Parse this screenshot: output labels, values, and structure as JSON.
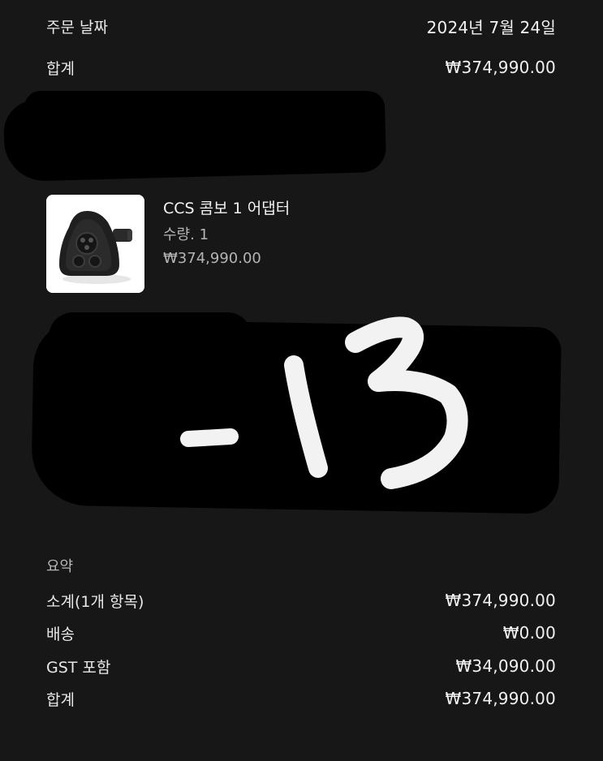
{
  "order": {
    "date_label": "주문 날짜",
    "date_value": "2024년 7월 24일",
    "total_label": "합계",
    "total_value": "₩374,990.00"
  },
  "product": {
    "title": "CCS 콤보 1 어댑터",
    "quantity": "수량. 1",
    "price": "₩374,990.00",
    "image_icon": "adapter-image"
  },
  "handwritten_note": "-13",
  "summary": {
    "title": "요약",
    "rows": [
      {
        "label": "소계(1개 항목)",
        "value": "₩374,990.00"
      },
      {
        "label": "배송",
        "value": "₩0.00"
      },
      {
        "label": "GST 포함",
        "value": "₩34,090.00"
      },
      {
        "label": "합계",
        "value": "₩374,990.00"
      }
    ]
  },
  "colors": {
    "background": "#171717",
    "text": "#ececec",
    "muted": "#b4b4b4"
  }
}
